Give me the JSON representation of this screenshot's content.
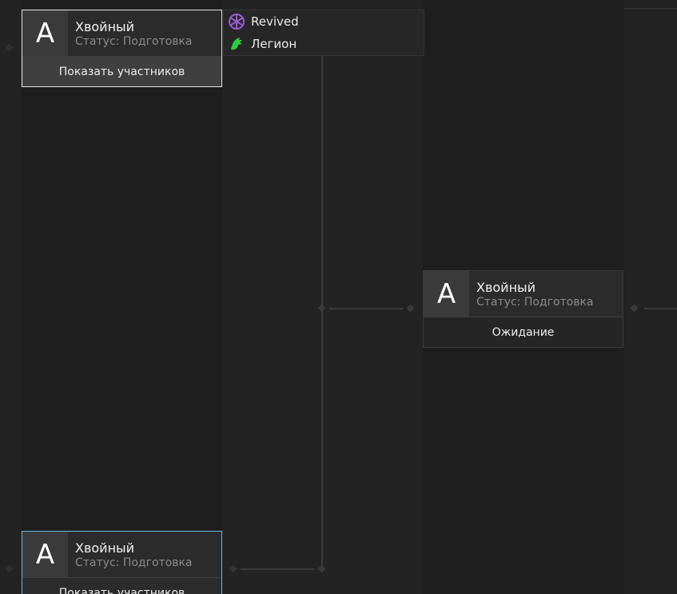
{
  "bracket": {
    "teams_panel": {
      "teams": [
        {
          "name": "Revived",
          "logo": "revived-logo-icon",
          "color": "#9b59d0"
        },
        {
          "name": "Легион",
          "logo": "legion-logo-icon",
          "color": "#2ecc40"
        }
      ]
    },
    "cards": [
      {
        "avatar_letter": "A",
        "team_name": "Хвойный",
        "status": "Статус: Подготовка",
        "action_label": "Показать участников",
        "highlight": "#e6e6e6"
      },
      {
        "avatar_letter": "A",
        "team_name": "Хвойный",
        "status": "Статус: Подготовка",
        "action_label": "Ожидание"
      },
      {
        "avatar_letter": "A",
        "team_name": "Хвойный",
        "status": "Статус: Подготовка",
        "action_label": "Показать участников",
        "highlight": "#6fb7dd"
      }
    ]
  }
}
